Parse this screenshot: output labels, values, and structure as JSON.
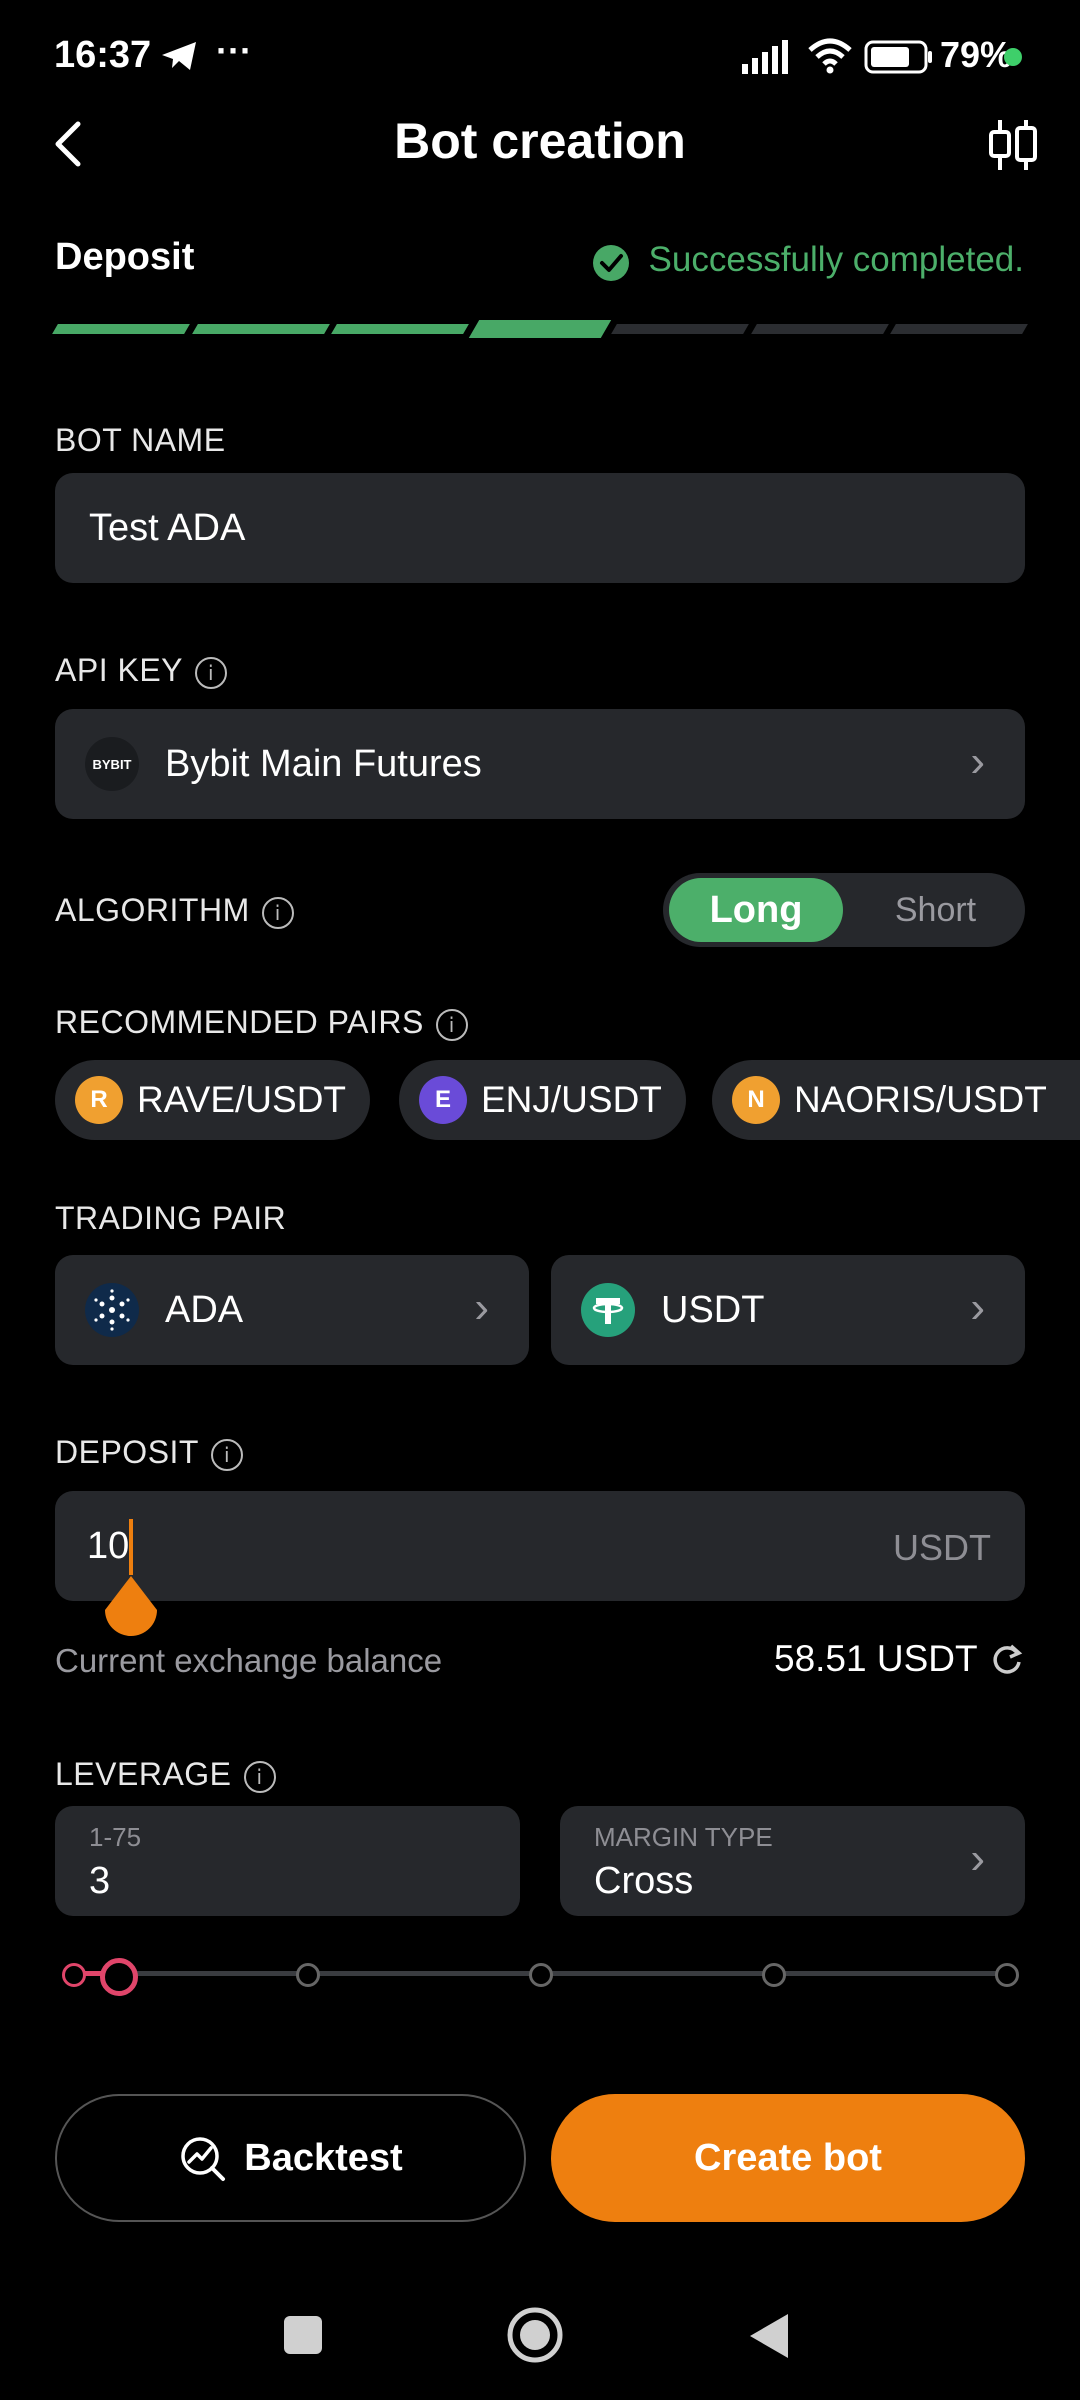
{
  "status_bar": {
    "time": "16:37",
    "more": "···",
    "battery": "79%"
  },
  "header": {
    "title": "Bot creation"
  },
  "steps": {
    "current_label": "Deposit",
    "status_text": "Successfully completed.",
    "total": 7,
    "completed": 4
  },
  "bot_name": {
    "label": "BOT NAME",
    "value": "Test ADA"
  },
  "api_key": {
    "label": "API KEY",
    "exchange_logo_text": "BYBIT",
    "value": "Bybit Main Futures"
  },
  "algorithm": {
    "label": "ALGORITHM",
    "options": [
      "Long",
      "Short"
    ],
    "selected": "Long"
  },
  "recommended": {
    "label": "RECOMMENDED PAIRS",
    "pairs": [
      {
        "letter": "R",
        "text": "RAVE/USDT",
        "color": "#F0A030"
      },
      {
        "letter": "E",
        "text": "ENJ/USDT",
        "color": "#6A4BD8"
      },
      {
        "letter": "N",
        "text": "NAORIS/USDT",
        "color": "#F0A030"
      }
    ]
  },
  "trading_pair": {
    "label": "TRADING PAIR",
    "base": "ADA",
    "quote": "USDT"
  },
  "deposit": {
    "label": "DEPOSIT",
    "value": "10",
    "unit": "USDT",
    "balance_label": "Current exchange balance",
    "balance_value": "58.51 USDT"
  },
  "leverage": {
    "label": "LEVERAGE",
    "range_label": "1-75",
    "value": "3",
    "margin_label": "MARGIN TYPE",
    "margin_value": "Cross",
    "slider_fraction": 0.027
  },
  "buttons": {
    "backtest": "Backtest",
    "create": "Create bot"
  },
  "colors": {
    "accent": "#EE7F0F",
    "success": "#4CAF6A",
    "field_bg": "#26282c"
  }
}
